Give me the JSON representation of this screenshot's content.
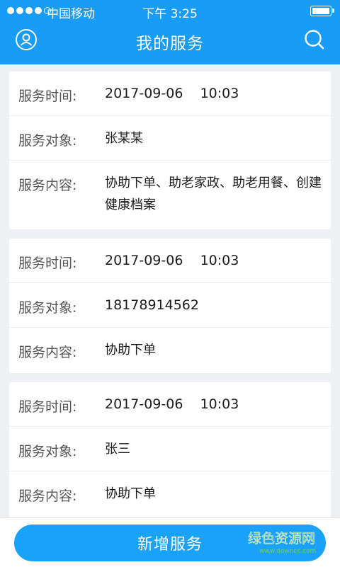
{
  "status_bar": {
    "carrier": "中国移动",
    "time": "下午 3:25"
  },
  "header": {
    "title": "我的服务"
  },
  "labels": {
    "time": "服务时间:",
    "target": "服务对象:",
    "content": "服务内容:"
  },
  "services": [
    {
      "time": "2017-09-06    10:03",
      "target": "张某某",
      "content": "协助下单、助老家政、助老用餐、创建健康档案"
    },
    {
      "time": "2017-09-06    10:03",
      "target": "18178914562",
      "content": "协助下单"
    },
    {
      "time": "2017-09-06    10:03",
      "target": "张三",
      "content": "协助下单"
    }
  ],
  "footer": {
    "add_label": "新增服务"
  },
  "watermark": {
    "text": "绿色资源网",
    "subtext": "www.downcc.com"
  },
  "colors": {
    "primary": "#199cf6",
    "button": "#19a2f8",
    "background": "#eef0f3"
  },
  "icons": {
    "profile": "user-circle-icon",
    "search": "search-icon"
  }
}
